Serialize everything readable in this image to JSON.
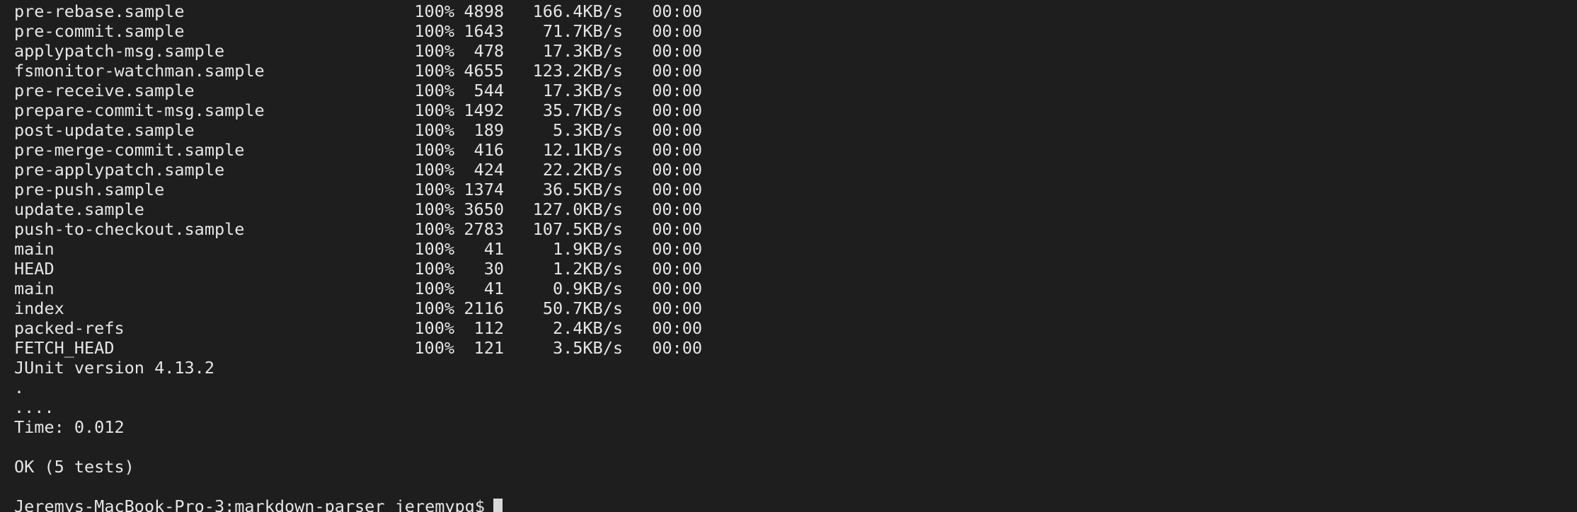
{
  "transfers": [
    {
      "name": "pre-rebase.sample",
      "percent": "100%",
      "size": "4898",
      "rate": "166.4KB/s",
      "time": "00:00"
    },
    {
      "name": "pre-commit.sample",
      "percent": "100%",
      "size": "1643",
      "rate": "71.7KB/s",
      "time": "00:00"
    },
    {
      "name": "applypatch-msg.sample",
      "percent": "100%",
      "size": "478",
      "rate": "17.3KB/s",
      "time": "00:00"
    },
    {
      "name": "fsmonitor-watchman.sample",
      "percent": "100%",
      "size": "4655",
      "rate": "123.2KB/s",
      "time": "00:00"
    },
    {
      "name": "pre-receive.sample",
      "percent": "100%",
      "size": "544",
      "rate": "17.3KB/s",
      "time": "00:00"
    },
    {
      "name": "prepare-commit-msg.sample",
      "percent": "100%",
      "size": "1492",
      "rate": "35.7KB/s",
      "time": "00:00"
    },
    {
      "name": "post-update.sample",
      "percent": "100%",
      "size": "189",
      "rate": "5.3KB/s",
      "time": "00:00"
    },
    {
      "name": "pre-merge-commit.sample",
      "percent": "100%",
      "size": "416",
      "rate": "12.1KB/s",
      "time": "00:00"
    },
    {
      "name": "pre-applypatch.sample",
      "percent": "100%",
      "size": "424",
      "rate": "22.2KB/s",
      "time": "00:00"
    },
    {
      "name": "pre-push.sample",
      "percent": "100%",
      "size": "1374",
      "rate": "36.5KB/s",
      "time": "00:00"
    },
    {
      "name": "update.sample",
      "percent": "100%",
      "size": "3650",
      "rate": "127.0KB/s",
      "time": "00:00"
    },
    {
      "name": "push-to-checkout.sample",
      "percent": "100%",
      "size": "2783",
      "rate": "107.5KB/s",
      "time": "00:00"
    },
    {
      "name": "main",
      "percent": "100%",
      "size": "41",
      "rate": "1.9KB/s",
      "time": "00:00"
    },
    {
      "name": "HEAD",
      "percent": "100%",
      "size": "30",
      "rate": "1.2KB/s",
      "time": "00:00"
    },
    {
      "name": "main",
      "percent": "100%",
      "size": "41",
      "rate": "0.9KB/s",
      "time": "00:00"
    },
    {
      "name": "index",
      "percent": "100%",
      "size": "2116",
      "rate": "50.7KB/s",
      "time": "00:00"
    },
    {
      "name": "packed-refs",
      "percent": "100%",
      "size": "112",
      "rate": "2.4KB/s",
      "time": "00:00"
    },
    {
      "name": "FETCH_HEAD",
      "percent": "100%",
      "size": "121",
      "rate": "3.5KB/s",
      "time": "00:00"
    }
  ],
  "output": {
    "junit_version": "JUnit version 4.13.2",
    "dot_line_1": ".",
    "dot_line_2": "....",
    "time": "Time: 0.012",
    "result": "OK (5 tests)"
  },
  "prompt": {
    "text": "Jeremys-MacBook-Pro-3:markdown-parser jeremypg$"
  },
  "colors": {
    "background": "#1e1e1e",
    "foreground": "#e6e6e6",
    "cursor": "#d9d9d9"
  }
}
